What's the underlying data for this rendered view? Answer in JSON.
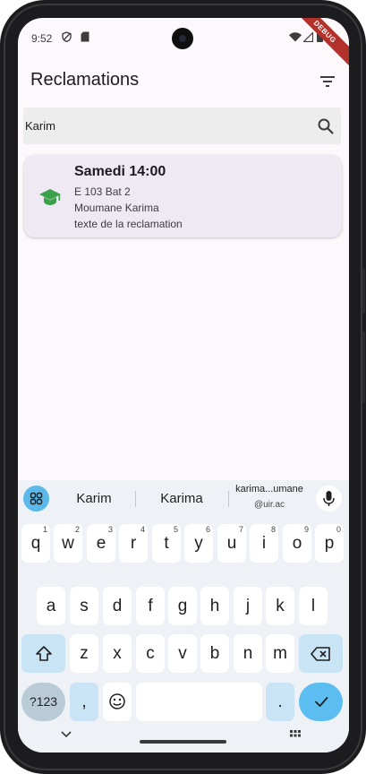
{
  "status_bar": {
    "time": "9:52",
    "debug_banner": "DEBUG"
  },
  "app_bar": {
    "title": "Reclamations",
    "filter_icon": "filter-list-icon"
  },
  "search": {
    "value": "Karim",
    "icon": "search-icon"
  },
  "reclamations": [
    {
      "title": "Samedi 14:00",
      "room": "E 103 Bat 2",
      "name": "Moumane Karima",
      "text": "texte de la reclamation",
      "icon": "graduation-cap-icon",
      "icon_color": "#3aa14a"
    }
  ],
  "keyboard": {
    "suggestions": [
      "Karim",
      "Karima"
    ],
    "email_suggestion": {
      "line1": "karima...umane",
      "line2": "@uir.ac"
    },
    "row1": [
      {
        "key": "q",
        "hint": "1"
      },
      {
        "key": "w",
        "hint": "2"
      },
      {
        "key": "e",
        "hint": "3"
      },
      {
        "key": "r",
        "hint": "4"
      },
      {
        "key": "t",
        "hint": "5"
      },
      {
        "key": "y",
        "hint": "6"
      },
      {
        "key": "u",
        "hint": "7"
      },
      {
        "key": "i",
        "hint": "8"
      },
      {
        "key": "o",
        "hint": "9"
      },
      {
        "key": "p",
        "hint": "0"
      }
    ],
    "row2": [
      "a",
      "s",
      "d",
      "f",
      "g",
      "h",
      "j",
      "k",
      "l"
    ],
    "row3": [
      "z",
      "x",
      "c",
      "v",
      "b",
      "n",
      "m"
    ],
    "symbols_label": "?123",
    "comma_label": ",",
    "period_label": ".",
    "accent_color": "#5cbef0"
  }
}
